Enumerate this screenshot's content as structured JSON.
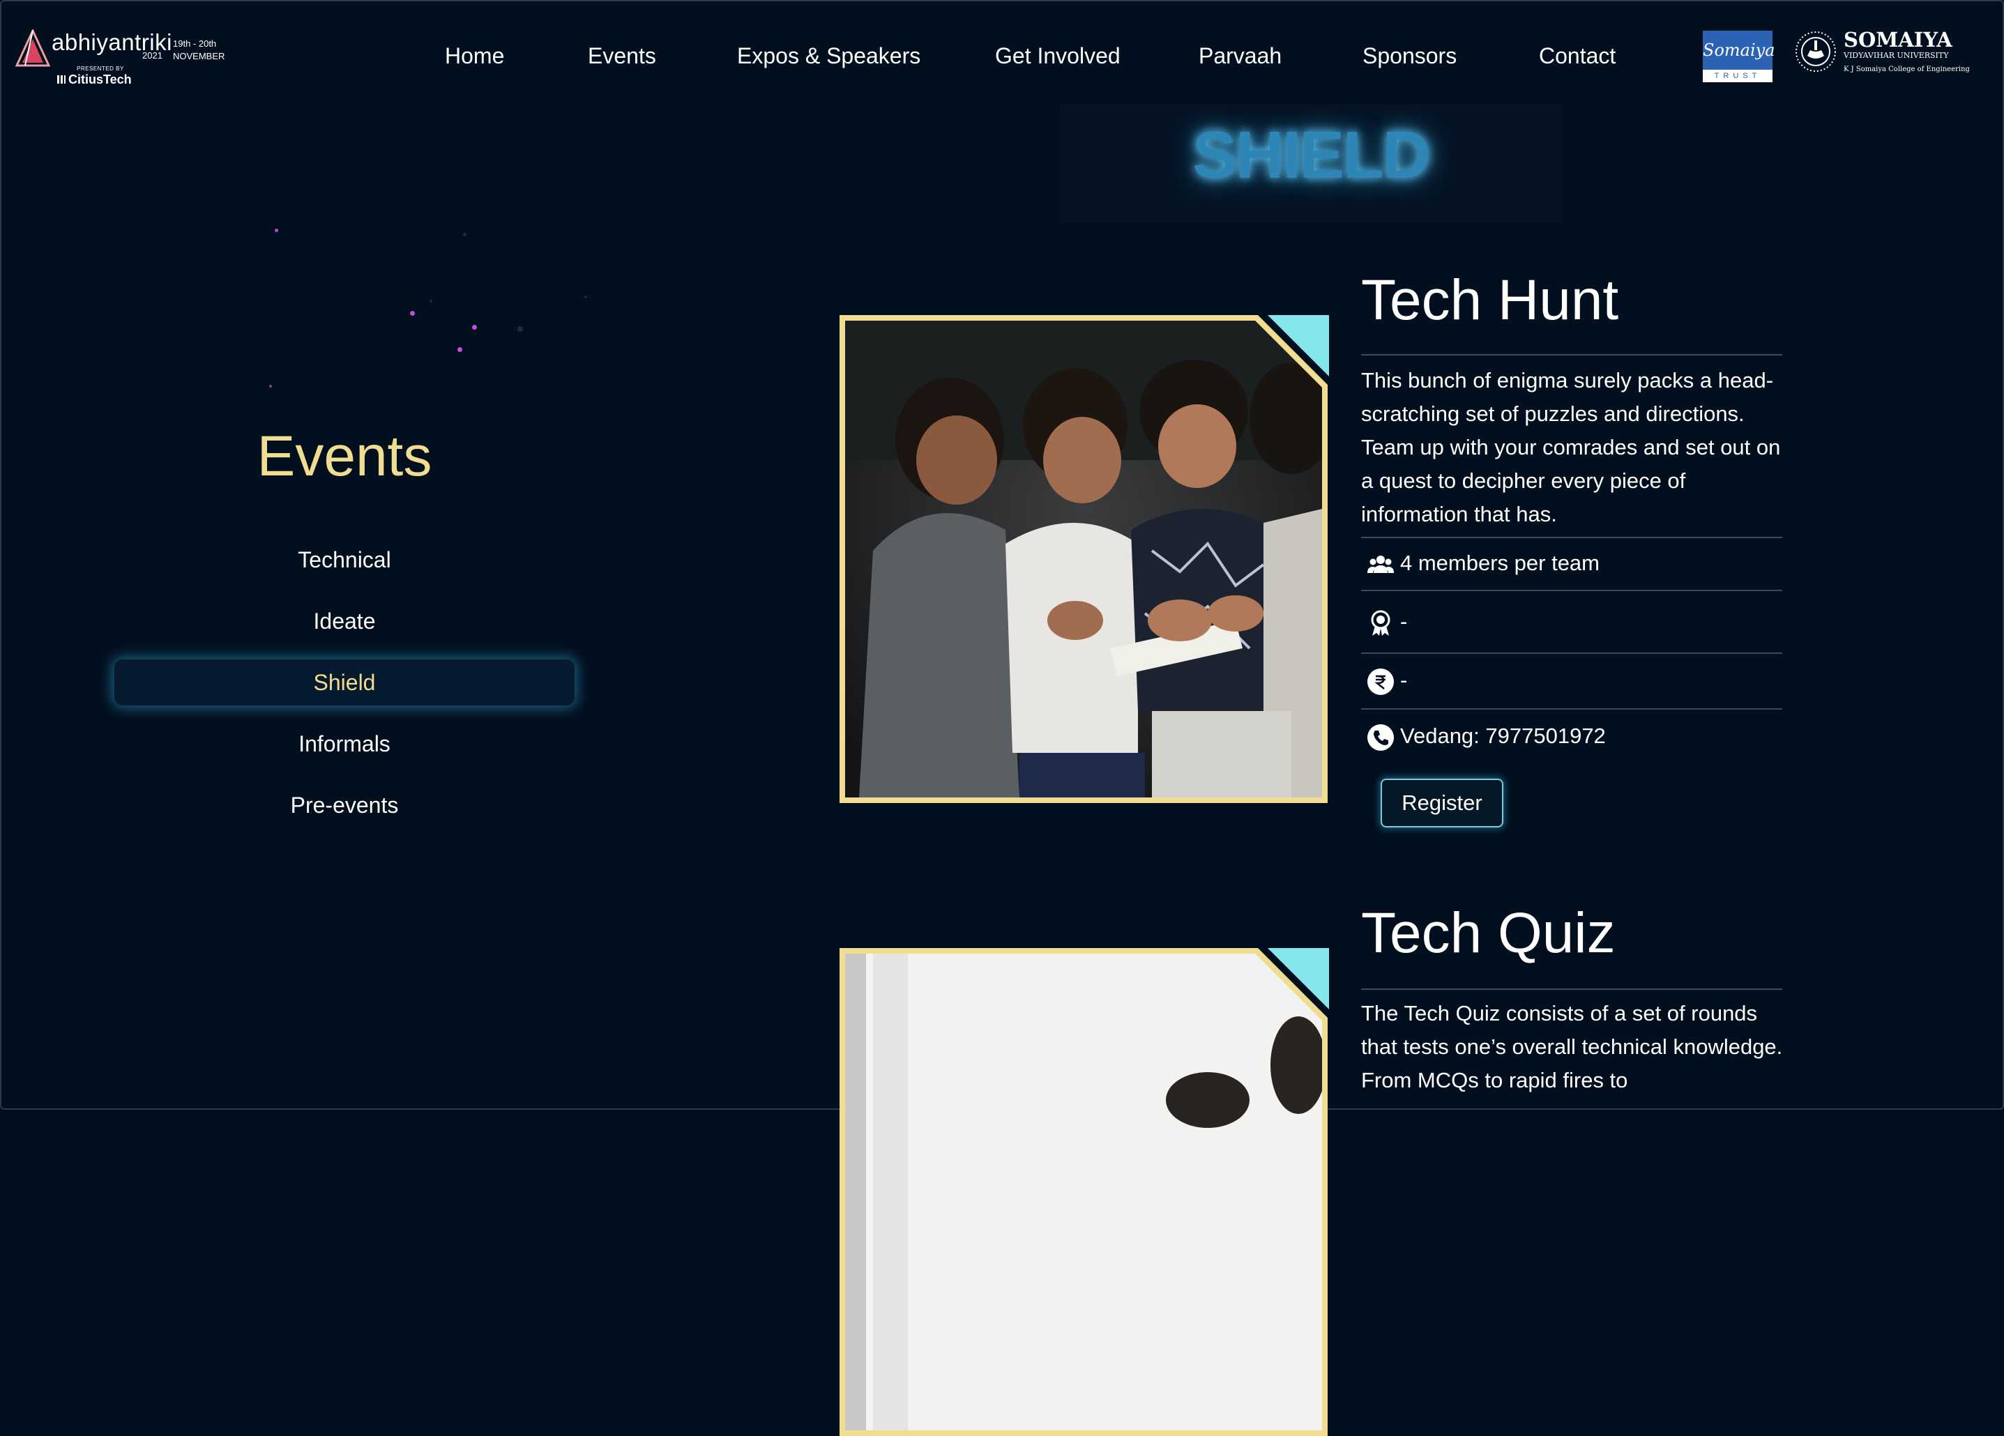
{
  "header": {
    "logo": {
      "wordmark": "abhiyantriki",
      "year": "2021",
      "dates_line1": "19th - 20th",
      "dates_line2": "NOVEMBER",
      "presented_by": "PRESENTED BY",
      "sponsor": "CitiusTech"
    },
    "nav": [
      "Home",
      "Events",
      "Expos & Speakers",
      "Get Involved",
      "Parvaah",
      "Sponsors",
      "Contact"
    ],
    "trust_logo": {
      "script": "Somaiya",
      "label": "TRUST"
    },
    "university_logo": {
      "name": "SOMAIYA",
      "sub": "VIDYAVIHAR UNIVERSITY",
      "college": "K J Somaiya College of Engineering"
    }
  },
  "page_title": "SHIELD",
  "sidebar": {
    "heading": "Events",
    "items": [
      {
        "label": "Technical",
        "active": false
      },
      {
        "label": "Ideate",
        "active": false
      },
      {
        "label": "Shield",
        "active": true
      },
      {
        "label": "Informals",
        "active": false
      },
      {
        "label": "Pre-events",
        "active": false
      }
    ]
  },
  "events": [
    {
      "title": "Tech Hunt",
      "description": "This bunch of enigma surely packs a head-scratching set of puzzles and directions. Team up with your comrades and set out on a quest to decipher every piece of information that has.",
      "team_size": "4 members per team",
      "prize": "-",
      "fee": "-",
      "contact": "Vedang: 7977501972",
      "register_label": "Register"
    },
    {
      "title": "Tech Quiz",
      "description": "The Tech Quiz consists of a set of rounds that tests one’s overall technical knowledge. From MCQs to rapid fires to"
    }
  ],
  "icons": {
    "team": "users-icon",
    "prize": "award-icon",
    "fee": "rupee-icon",
    "contact": "phone-icon"
  },
  "colors": {
    "background": "#020f1f",
    "accent_gold": "#f1dd92",
    "accent_cyan": "#85e6ee",
    "title_glow": "#62c4ef"
  }
}
